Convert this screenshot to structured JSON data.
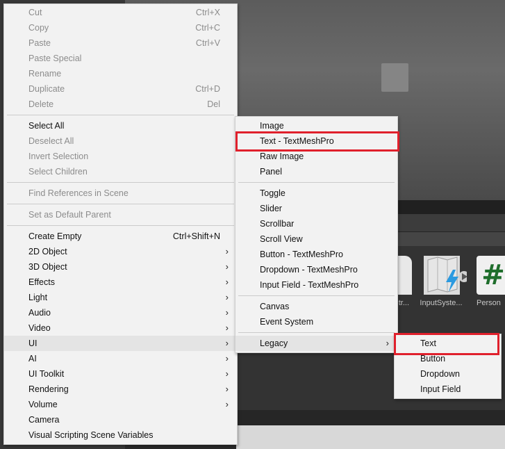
{
  "background": {
    "assets": [
      {
        "label": "tr...",
        "icon": "document-icon"
      },
      {
        "label": "InputSyste...",
        "icon": "input-system-asset-icon"
      },
      {
        "label": "Person",
        "icon": "csharp-script-icon"
      }
    ]
  },
  "context_menu": {
    "items": [
      {
        "label": "Cut",
        "shortcut": "Ctrl+X",
        "disabled": true
      },
      {
        "label": "Copy",
        "shortcut": "Ctrl+C",
        "disabled": true
      },
      {
        "label": "Paste",
        "shortcut": "Ctrl+V",
        "disabled": true
      },
      {
        "label": "Paste Special",
        "shortcut": "",
        "disabled": true
      },
      {
        "label": "Rename",
        "shortcut": "",
        "disabled": true
      },
      {
        "label": "Duplicate",
        "shortcut": "Ctrl+D",
        "disabled": true
      },
      {
        "label": "Delete",
        "shortcut": "Del",
        "disabled": true
      },
      {
        "label": "Select All",
        "shortcut": "",
        "disabled": false
      },
      {
        "label": "Deselect All",
        "shortcut": "",
        "disabled": true
      },
      {
        "label": "Invert Selection",
        "shortcut": "",
        "disabled": true
      },
      {
        "label": "Select Children",
        "shortcut": "",
        "disabled": true
      },
      {
        "label": "Find References in Scene",
        "shortcut": "",
        "disabled": true
      },
      {
        "label": "Set as Default Parent",
        "shortcut": "",
        "disabled": true
      },
      {
        "label": "Create Empty",
        "shortcut": "Ctrl+Shift+N",
        "disabled": false
      },
      {
        "label": "2D Object",
        "submenu": true
      },
      {
        "label": "3D Object",
        "submenu": true
      },
      {
        "label": "Effects",
        "submenu": true
      },
      {
        "label": "Light",
        "submenu": true
      },
      {
        "label": "Audio",
        "submenu": true
      },
      {
        "label": "Video",
        "submenu": true
      },
      {
        "label": "UI",
        "submenu": true,
        "highlighted": true
      },
      {
        "label": "AI",
        "submenu": true
      },
      {
        "label": "UI Toolkit",
        "submenu": true
      },
      {
        "label": "Rendering",
        "submenu": true
      },
      {
        "label": "Volume",
        "submenu": true
      },
      {
        "label": "Camera"
      },
      {
        "label": "Visual Scripting Scene Variables"
      }
    ]
  },
  "ui_submenu": {
    "items": [
      {
        "label": "Image"
      },
      {
        "label": "Text - TextMeshPro",
        "outlined": true
      },
      {
        "label": "Raw Image"
      },
      {
        "label": "Panel"
      },
      {
        "label": "Toggle"
      },
      {
        "label": "Slider"
      },
      {
        "label": "Scrollbar"
      },
      {
        "label": "Scroll View"
      },
      {
        "label": "Button - TextMeshPro"
      },
      {
        "label": "Dropdown - TextMeshPro"
      },
      {
        "label": "Input Field - TextMeshPro"
      },
      {
        "label": "Canvas"
      },
      {
        "label": "Event System"
      },
      {
        "label": "Legacy",
        "submenu": true,
        "highlighted": true
      }
    ]
  },
  "legacy_submenu": {
    "items": [
      {
        "label": "Text",
        "outlined": true
      },
      {
        "label": "Button"
      },
      {
        "label": "Dropdown"
      },
      {
        "label": "Input Field"
      }
    ]
  },
  "colors": {
    "menu_bg": "#f2f2f2",
    "highlight": "#e4e4e4",
    "disabled_text": "#8c8c8c",
    "annotation_red": "#e0202c"
  },
  "icons": {
    "submenu_arrow": "chevron-right-icon",
    "submenu_arrow_glyph": "›"
  }
}
